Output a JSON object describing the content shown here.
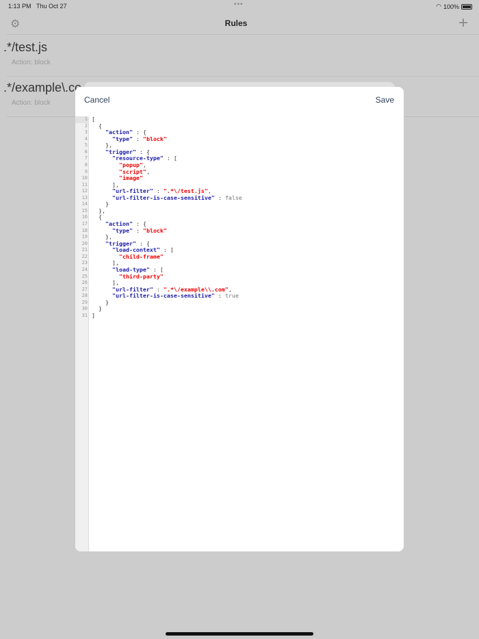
{
  "status": {
    "time": "1:13 PM",
    "date": "Thu Oct 27",
    "battery": "100%"
  },
  "nav": {
    "title": "Rules",
    "settings_icon": "gear-icon",
    "add_icon": "plus-icon"
  },
  "rules": [
    {
      "pattern": ".*/test.js",
      "action": "Action:  block"
    },
    {
      "pattern": ".*/example\\.co",
      "action": "Action:  block"
    }
  ],
  "modal": {
    "cancel": "Cancel",
    "save": "Save",
    "lines": [
      [
        [
          "p",
          "["
        ]
      ],
      [
        [
          "p",
          "  {"
        ]
      ],
      [
        [
          "k",
          "    \"action\""
        ],
        [
          "p",
          " : {"
        ]
      ],
      [
        [
          "k",
          "      \"type\""
        ],
        [
          "p",
          " : "
        ],
        [
          "s",
          "\"block\""
        ]
      ],
      [
        [
          "p",
          "    },"
        ]
      ],
      [
        [
          "k",
          "    \"trigger\""
        ],
        [
          "p",
          " : {"
        ]
      ],
      [
        [
          "k",
          "      \"resource-type\""
        ],
        [
          "p",
          " : ["
        ]
      ],
      [
        [
          "s",
          "        \"popup\""
        ],
        [
          "p",
          ","
        ]
      ],
      [
        [
          "s",
          "        \"script\""
        ],
        [
          "p",
          ","
        ]
      ],
      [
        [
          "s",
          "        \"image\""
        ]
      ],
      [
        [
          "p",
          "      ],"
        ]
      ],
      [
        [
          "k",
          "      \"url-filter\""
        ],
        [
          "p",
          " : "
        ],
        [
          "s",
          "\".*\\/test.js\""
        ],
        [
          "p",
          ","
        ]
      ],
      [
        [
          "k",
          "      \"url-filter-is-case-sensitive\""
        ],
        [
          "p",
          " : "
        ],
        [
          "b",
          "false"
        ]
      ],
      [
        [
          "p",
          "    }"
        ]
      ],
      [
        [
          "p",
          "  },"
        ]
      ],
      [
        [
          "p",
          "  {"
        ]
      ],
      [
        [
          "k",
          "    \"action\""
        ],
        [
          "p",
          " : {"
        ]
      ],
      [
        [
          "k",
          "      \"type\""
        ],
        [
          "p",
          " : "
        ],
        [
          "s",
          "\"block\""
        ]
      ],
      [
        [
          "p",
          "    },"
        ]
      ],
      [
        [
          "k",
          "    \"trigger\""
        ],
        [
          "p",
          " : {"
        ]
      ],
      [
        [
          "k",
          "      \"load-context\""
        ],
        [
          "p",
          " : ["
        ]
      ],
      [
        [
          "s",
          "        \"child-frame\""
        ]
      ],
      [
        [
          "p",
          "      ],"
        ]
      ],
      [
        [
          "k",
          "      \"load-type\""
        ],
        [
          "p",
          " : ["
        ]
      ],
      [
        [
          "s",
          "        \"third-party\""
        ]
      ],
      [
        [
          "p",
          "      ],"
        ]
      ],
      [
        [
          "k",
          "      \"url-filter\""
        ],
        [
          "p",
          " : "
        ],
        [
          "s",
          "\".*\\/example\\\\.com\""
        ],
        [
          "p",
          ","
        ]
      ],
      [
        [
          "k",
          "      \"url-filter-is-case-sensitive\""
        ],
        [
          "p",
          " : "
        ],
        [
          "b",
          "true"
        ]
      ],
      [
        [
          "p",
          "    }"
        ]
      ],
      [
        [
          "p",
          "  }"
        ]
      ],
      [
        [
          "p",
          "]"
        ]
      ]
    ]
  },
  "colors": {
    "key": "#1a1aa6",
    "string": "#e00000",
    "boolean": "#777777",
    "overlay": "#cccccc"
  }
}
